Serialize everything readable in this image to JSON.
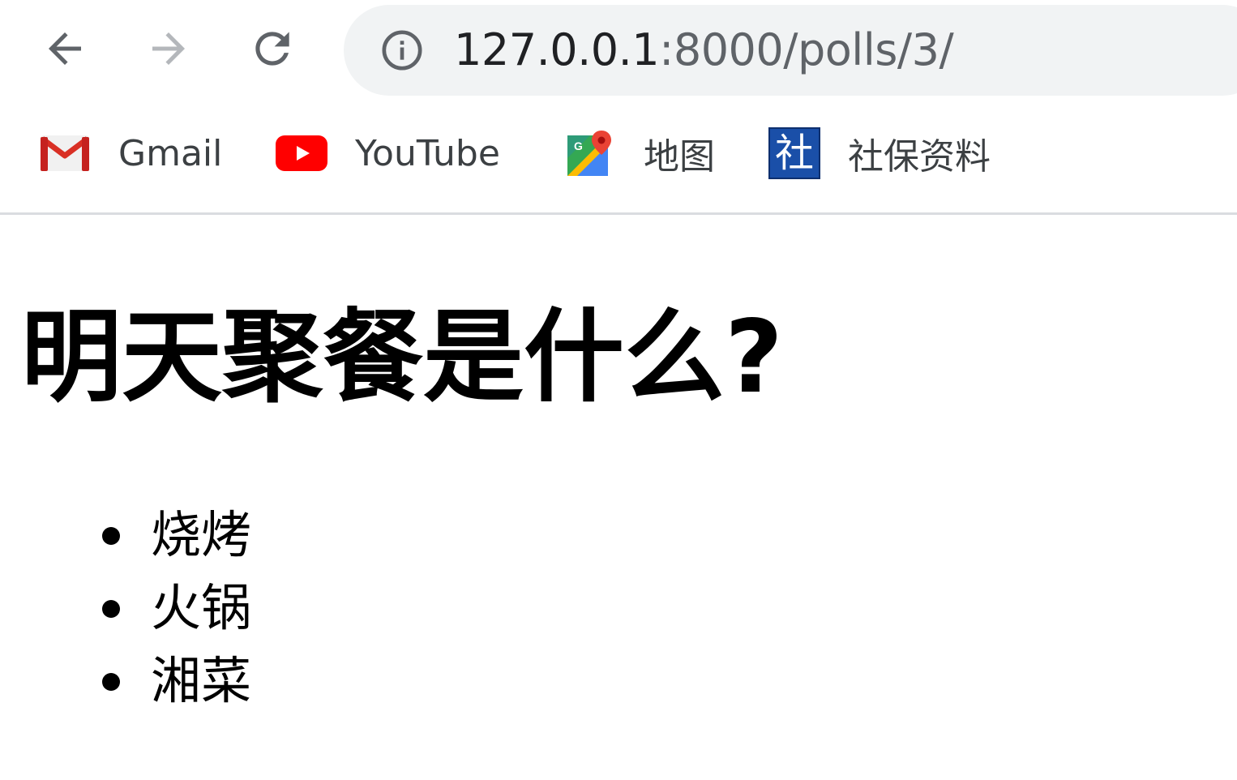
{
  "browser": {
    "url_host": "127.0.0.1",
    "url_path": ":8000/polls/3/",
    "toolbar_icons": [
      "back-arrow-icon",
      "forward-arrow-icon",
      "reload-icon",
      "info-icon"
    ]
  },
  "bookmarks": [
    {
      "label": "Gmail",
      "icon": "gmail-icon"
    },
    {
      "label": "YouTube",
      "icon": "youtube-icon"
    },
    {
      "label": "地图",
      "icon": "maps-icon"
    },
    {
      "label": "社保资料",
      "icon": "she-icon",
      "icon_glyph": "社"
    }
  ],
  "page": {
    "question": "明天聚餐是什么?",
    "choices": [
      "烧烤",
      "火锅",
      "湘菜"
    ]
  },
  "colors": {
    "omnibox_bg": "#f1f3f4",
    "youtube_red": "#ff0000",
    "gmail_red": "#d93025",
    "shebao_blue": "#1a4fa8"
  }
}
